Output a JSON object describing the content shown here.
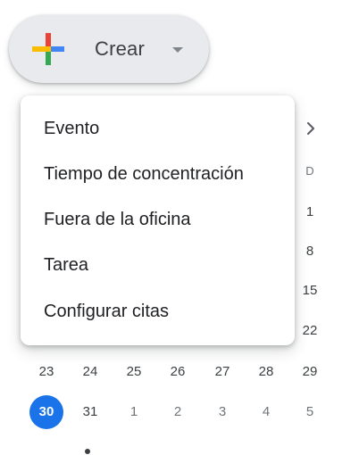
{
  "create_button": {
    "label": "Crear",
    "icon": "google-plus-icon",
    "caret_icon": "caret-down-icon"
  },
  "menu": {
    "items": [
      {
        "label": "Evento"
      },
      {
        "label": "Tiempo de concentración"
      },
      {
        "label": "Fuera de la oficina"
      },
      {
        "label": "Tarea"
      },
      {
        "label": "Configurar citas"
      }
    ]
  },
  "mini_calendar": {
    "next_icon": "chevron-right-icon",
    "weekday_last": "D",
    "right_column": [
      "1",
      "8",
      "15",
      "22"
    ],
    "week_5": [
      "23",
      "24",
      "25",
      "26",
      "27",
      "28",
      "29"
    ],
    "week_6": [
      "30",
      "31",
      "1",
      "2",
      "3",
      "4",
      "5"
    ],
    "today": "30"
  },
  "colors": {
    "accent": "#1a73e8",
    "plus_blue": "#4285f4",
    "plus_red": "#ea4335",
    "plus_yellow": "#fbbc04",
    "plus_green": "#34a853",
    "button_bg": "#e8eaed"
  }
}
